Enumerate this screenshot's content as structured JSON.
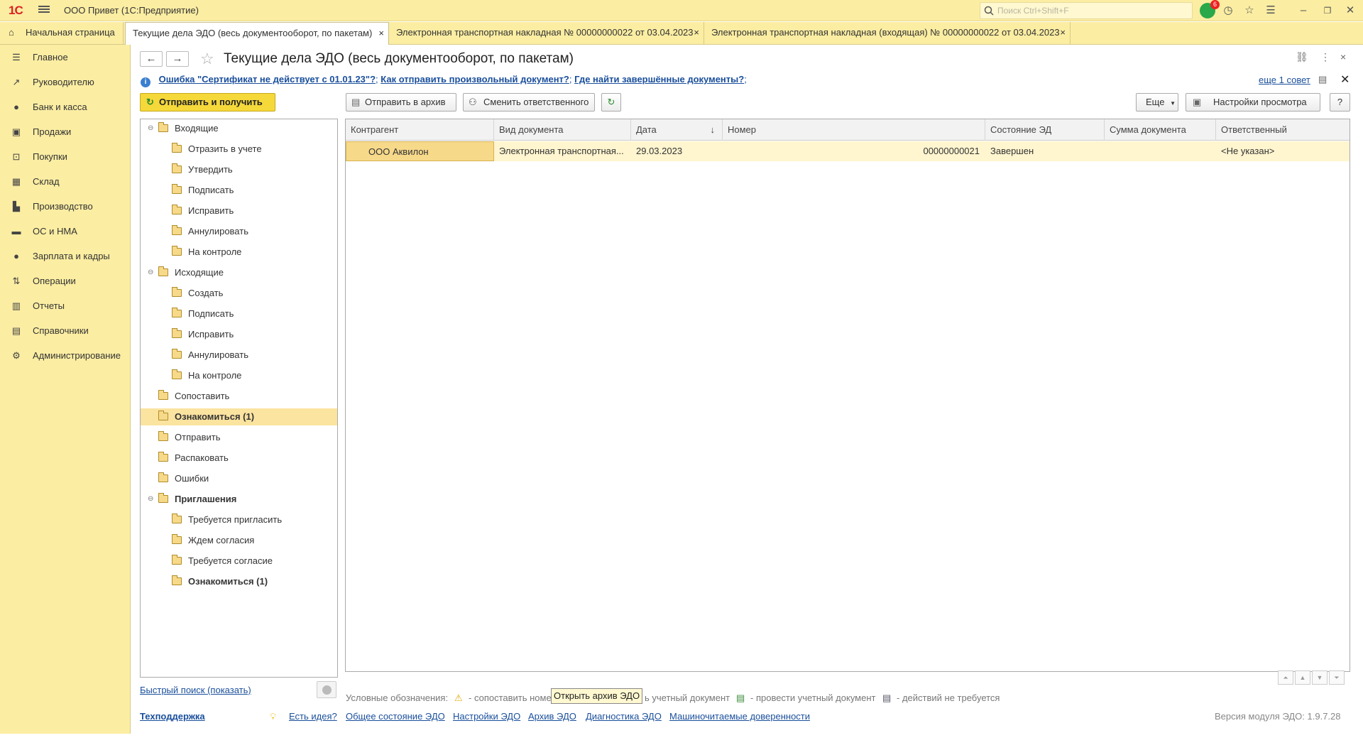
{
  "app": {
    "title": "ООО Привет  (1С:Предприятие)",
    "logo": "1С",
    "search_placeholder": "Поиск Ctrl+Shift+F",
    "notifications_count": "6"
  },
  "tabs": [
    {
      "label": "Начальная страница"
    },
    {
      "label": "Текущие дела ЭДО (весь документооборот, по пакетам)"
    },
    {
      "label": "Электронная транспортная накладная № 00000000022 от 03.04.2023"
    },
    {
      "label": "Электронная транспортная накладная (входящая) № 00000000022 от 03.04.2023"
    }
  ],
  "sidebar": {
    "items": [
      {
        "label": "Главное",
        "icon": "menu-icon"
      },
      {
        "label": "Руководителю",
        "icon": "trend-icon"
      },
      {
        "label": "Банк и касса",
        "icon": "coins-icon"
      },
      {
        "label": "Продажи",
        "icon": "bag-icon"
      },
      {
        "label": "Покупки",
        "icon": "cart-icon"
      },
      {
        "label": "Склад",
        "icon": "warehouse-icon"
      },
      {
        "label": "Производство",
        "icon": "factory-icon"
      },
      {
        "label": "ОС и НМА",
        "icon": "truck-icon"
      },
      {
        "label": "Зарплата и кадры",
        "icon": "person-icon"
      },
      {
        "label": "Операции",
        "icon": "operations-icon"
      },
      {
        "label": "Отчеты",
        "icon": "chart-icon"
      },
      {
        "label": "Справочники",
        "icon": "book-icon"
      },
      {
        "label": "Администрирование",
        "icon": "gear-icon"
      }
    ]
  },
  "page": {
    "title": "Текущие дела ЭДО (весь документооборот, по пакетам)",
    "info_links": [
      "Ошибка \"Сертификат не действует с 01.01.23\"?",
      "Как отправить произвольный документ?",
      "Где найти завершённые документы?"
    ],
    "more_tips": "еще 1 совет"
  },
  "toolbar": {
    "send_receive": "Отправить и получить",
    "archive": "Отправить в архив",
    "change_responsible": "Сменить ответственного",
    "more": "Еще",
    "view_settings": "Настройки просмотра",
    "help": "?"
  },
  "tree": [
    {
      "label": "Входящие",
      "level": 0,
      "toggle": "⊖"
    },
    {
      "label": "Отразить в учете",
      "level": 1
    },
    {
      "label": "Утвердить",
      "level": 1
    },
    {
      "label": "Подписать",
      "level": 1
    },
    {
      "label": "Исправить",
      "level": 1
    },
    {
      "label": "Аннулировать",
      "level": 1
    },
    {
      "label": "На контроле",
      "level": 1
    },
    {
      "label": "Исходящие",
      "level": 0,
      "toggle": "⊖"
    },
    {
      "label": "Создать",
      "level": 1
    },
    {
      "label": "Подписать",
      "level": 1
    },
    {
      "label": "Исправить",
      "level": 1
    },
    {
      "label": "Аннулировать",
      "level": 1
    },
    {
      "label": "На контроле",
      "level": 1
    },
    {
      "label": "Сопоставить",
      "level": 0
    },
    {
      "label": "Ознакомиться (1)",
      "level": 0,
      "bold": true,
      "selected": true
    },
    {
      "label": "Отправить",
      "level": 0
    },
    {
      "label": "Распаковать",
      "level": 0
    },
    {
      "label": "Ошибки",
      "level": 0
    },
    {
      "label": "Приглашения",
      "level": 0,
      "bold": true,
      "toggle": "⊖"
    },
    {
      "label": "Требуется пригласить",
      "level": 1
    },
    {
      "label": "Ждем согласия",
      "level": 1
    },
    {
      "label": "Требуется согласие",
      "level": 1
    },
    {
      "label": "Ознакомиться (1)",
      "level": 1,
      "bold": true
    }
  ],
  "table": {
    "columns": [
      "Контрагент",
      "Вид документа",
      "Дата",
      "Номер",
      "Состояние ЭД",
      "Сумма документа",
      "Ответственный"
    ],
    "sort_indicator": "↓",
    "rows": [
      {
        "counterparty": "ООО Аквилон",
        "doc_type": "Электронная транспортная...",
        "date": "29.03.2023",
        "number": "00000000021",
        "state": "Завершен",
        "sum": "",
        "responsible": "<Не указан>"
      }
    ]
  },
  "quick_search": "Быстрый поиск (показать)",
  "legend": {
    "title": "Условные обозначения:",
    "items": [
      "- сопоставить номен",
      "ь учетный документ",
      "- провести учетный документ",
      "- действий не требуется"
    ]
  },
  "tooltip": "Открыть архив ЭДО",
  "footer": {
    "support": "Техподдержка",
    "links": [
      "Есть идея?",
      "Общее состояние ЭДО",
      "Настройки ЭДО",
      "Архив ЭДО",
      "Диагностика ЭДО",
      "Машиночитаемые доверенности"
    ],
    "version": "Версия модуля ЭДО: 1.9.7.28"
  },
  "colors": {
    "accent": "#fbeda2",
    "button_primary": "#f5d83a",
    "link": "#1a4f9c",
    "selection": "#f7d98a"
  }
}
